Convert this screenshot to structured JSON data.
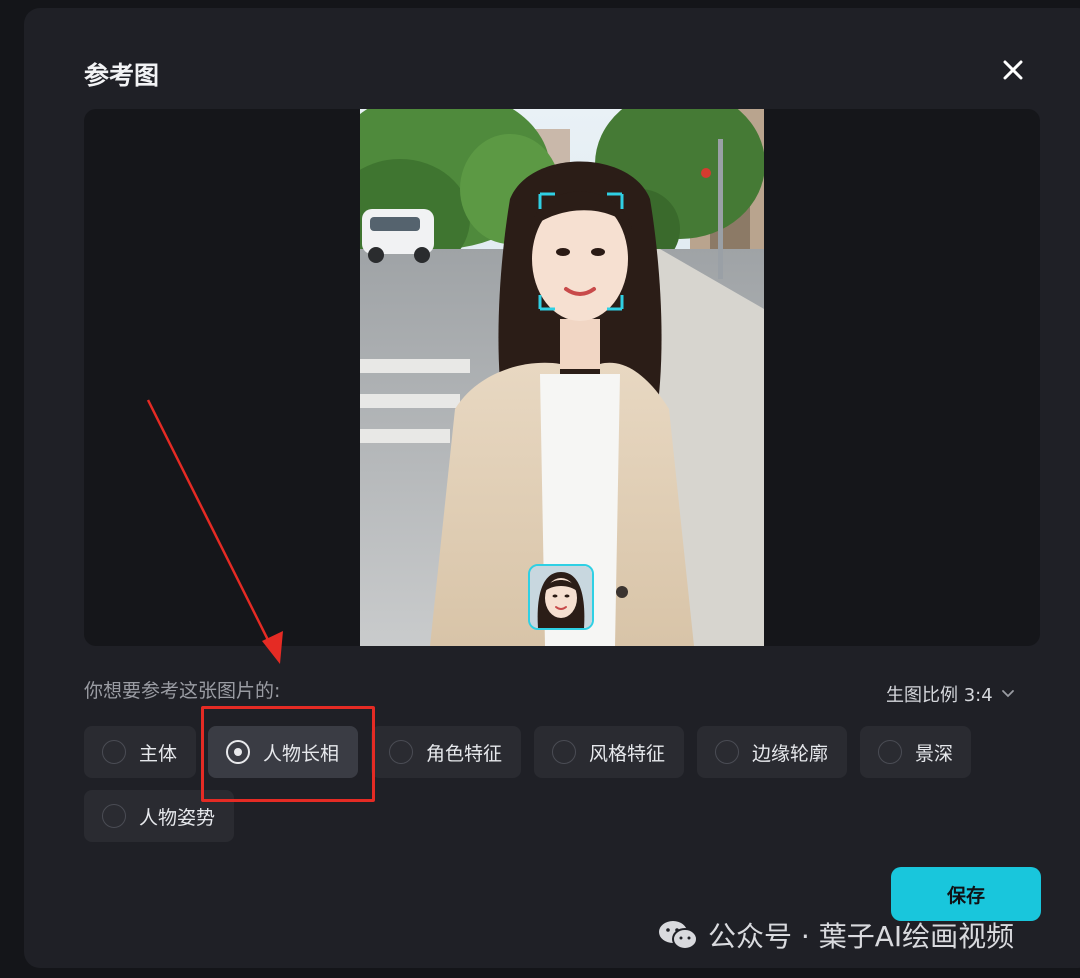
{
  "dialog": {
    "title": "参考图"
  },
  "question": "你想要参考这张图片的:",
  "ratio": {
    "label": "生图比例 3:4"
  },
  "options": [
    {
      "label": "主体",
      "selected": false
    },
    {
      "label": "人物长相",
      "selected": true
    },
    {
      "label": "角色特征",
      "selected": false
    },
    {
      "label": "风格特征",
      "selected": false
    },
    {
      "label": "边缘轮廓",
      "selected": false
    },
    {
      "label": "景深",
      "selected": false
    },
    {
      "label": "人物姿势",
      "selected": false
    }
  ],
  "save_label": "保存",
  "watermark": {
    "text": "公众号 · 葉子AI绘画视频",
    "icon": "wechat-icon"
  },
  "colors": {
    "accent": "#19c6dc",
    "annotation": "#e52b24",
    "face_frame": "#2fd0e4"
  },
  "icons": {
    "close": "close-icon",
    "dropdown": "chevron-down-icon"
  }
}
